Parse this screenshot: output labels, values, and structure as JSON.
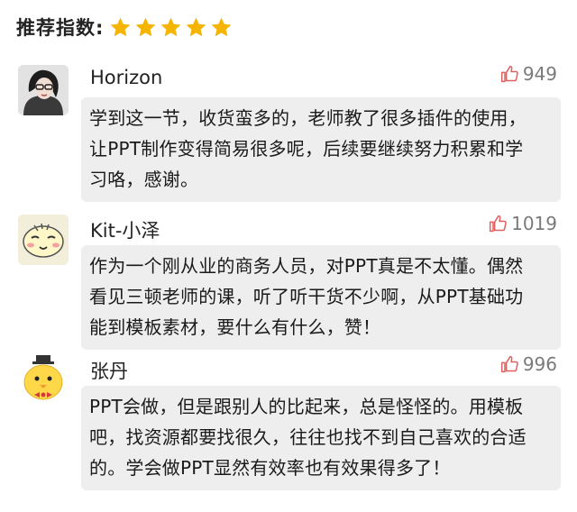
{
  "rating": {
    "label": "推荐指数:",
    "stars": 5,
    "star_color": "#f5b400"
  },
  "comments": [
    {
      "username": "Horizon",
      "likes": "949",
      "avatar": "photo-avatar",
      "lines": [
        "学到这一节，收货蛮多的，老师教了很多插件的使用，",
        "让PPT制作变得简易很多呢，后续要继续努力积累和学",
        "习咯，感谢。"
      ]
    },
    {
      "username": "Kit-小泽",
      "likes": "1019",
      "avatar": "cartoon-face-avatar",
      "lines": [
        "作为一个刚从业的商务人员，对PPT真是不太懂。偶然",
        "看见三顿老师的课，听了听干货不少啊，从PPT基础功",
        "能到模板素材，要什么有什么，赞！"
      ]
    },
    {
      "username": "张丹",
      "likes": "996",
      "avatar": "yellow-chick-avatar",
      "lines": [
        "PPT会做，但是跟别人的比起来，总是怪怪的。用模板",
        "吧，找资源都要找很久，往往也找不到自己喜欢的合适",
        "的。学会做PPT显然有效率也有效果得多了！"
      ]
    }
  ],
  "colors": {
    "bubble_bg": "#eeeeee",
    "like_color": "#7a7a7a"
  }
}
